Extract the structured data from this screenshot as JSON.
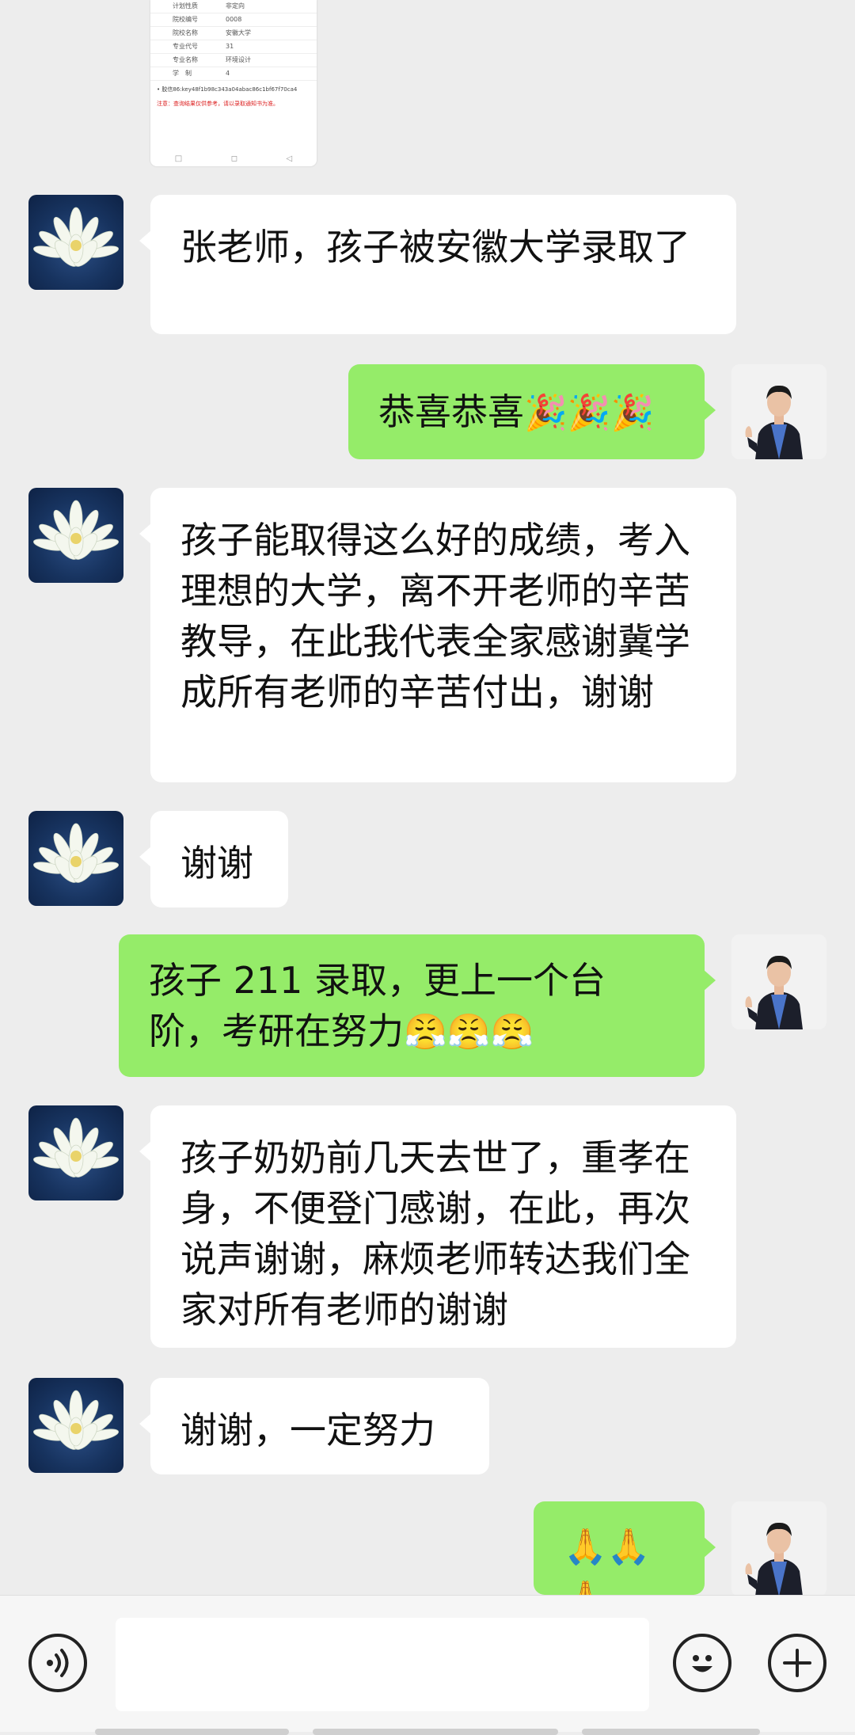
{
  "document_preview": {
    "rows": [
      {
        "label": "计划性质",
        "value": "非定向"
      },
      {
        "label": "院校编号",
        "value": "0008"
      },
      {
        "label": "院校名称",
        "value": "安徽大学"
      },
      {
        "label": "专业代号",
        "value": "31"
      },
      {
        "label": "专业名称",
        "value": "环境设计"
      },
      {
        "label": "学　制",
        "value": "4"
      }
    ],
    "link_text": "• 胶信86:key48f1b98c343a04abac86c1bf67f70ca4",
    "note_text": "注意：查询结果仅供参考，请以录取通知书为准。",
    "nav": [
      "□",
      "◻",
      "◁"
    ]
  },
  "messages": [
    {
      "id": "m1",
      "side": "in",
      "sender": "lotus",
      "text": "张老师，孩子被安徽大学录取了"
    },
    {
      "id": "m2",
      "side": "out",
      "sender": "teacher",
      "text": "恭喜恭喜",
      "emoji": "🎉🎉🎉"
    },
    {
      "id": "m3",
      "side": "in",
      "sender": "lotus",
      "text": "孩子能取得这么好的成绩，考入理想的大学，离不开老师的辛苦教导，在此我代表全家感谢冀学成所有老师的辛苦付出，谢谢"
    },
    {
      "id": "m4",
      "side": "in",
      "sender": "lotus",
      "text": "谢谢"
    },
    {
      "id": "m5",
      "side": "out",
      "sender": "teacher",
      "text": "孩子 211 录取，更上一个台阶，考研在努力",
      "emoji": "😤😤😤"
    },
    {
      "id": "m6",
      "side": "in",
      "sender": "lotus",
      "text": "孩子奶奶前几天去世了，重孝在身，不便登门感谢，在此，再次说声谢谢，麻烦老师转达我们全家对所有老师的谢谢"
    },
    {
      "id": "m7",
      "side": "in",
      "sender": "lotus",
      "text": "谢谢，一定努力"
    },
    {
      "id": "m8",
      "side": "out",
      "sender": "teacher",
      "text": "",
      "emoji": "🙏🙏🙏"
    }
  ],
  "input_bar": {
    "voice_icon": "voice-icon",
    "emoji_icon": "emoji-icon",
    "plus_icon": "plus-icon",
    "placeholder": ""
  },
  "colors": {
    "background": "#ededed",
    "incoming_bubble": "#ffffff",
    "outgoing_bubble": "#95ec69"
  }
}
